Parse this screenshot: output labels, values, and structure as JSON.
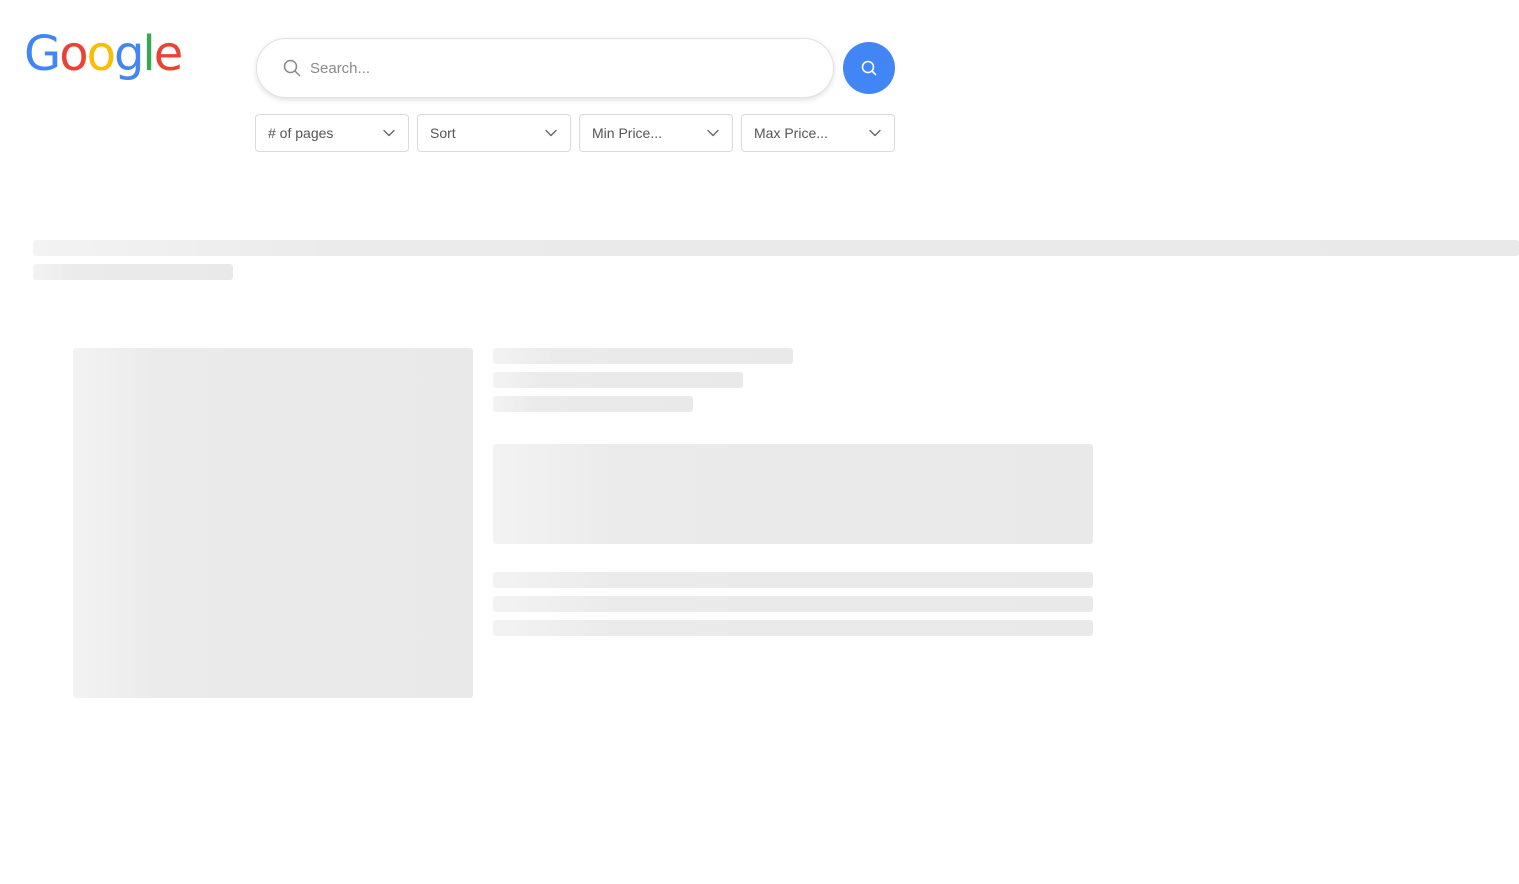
{
  "logo": {
    "letters": [
      "G",
      "o",
      "o",
      "g",
      "l",
      "e"
    ],
    "colors": [
      "#4285F4",
      "#EA4335",
      "#FBBC05",
      "#4285F4",
      "#34A853",
      "#EA4335"
    ]
  },
  "search": {
    "placeholder": "Search...",
    "value": "",
    "icon": "search-icon"
  },
  "search_button": {
    "icon": "search-icon",
    "color": "#4285f4"
  },
  "filters": [
    {
      "label": "# of pages",
      "icon": "chevron-down-icon"
    },
    {
      "label": "Sort",
      "icon": "chevron-down-icon"
    },
    {
      "label": "Min Price...",
      "icon": "chevron-down-icon"
    },
    {
      "label": "Max Price...",
      "icon": "chevron-down-icon"
    }
  ],
  "results": {
    "state": "loading"
  }
}
